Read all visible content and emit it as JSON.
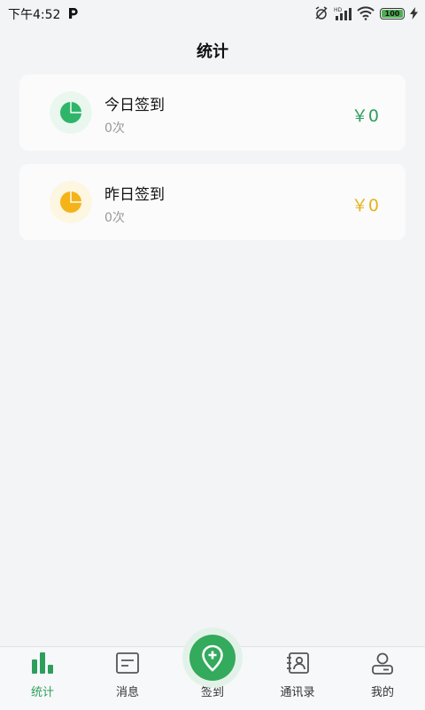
{
  "status_bar": {
    "time": "下午4:52",
    "battery": "100"
  },
  "header": {
    "title": "统计"
  },
  "cards": [
    {
      "title": "今日签到",
      "count": "0次",
      "amount": "￥0",
      "amount_color": "#2e9e5b",
      "icon": "pie-chart-icon"
    },
    {
      "title": "昨日签到",
      "count": "0次",
      "amount": "￥0",
      "amount_color": "#e6b31a",
      "icon": "pie-chart-icon"
    }
  ],
  "tabbar": {
    "tabs": [
      {
        "label": "统计",
        "icon": "bar-chart-icon",
        "active": true
      },
      {
        "label": "消息",
        "icon": "message-icon"
      },
      {
        "label": "签到",
        "icon": "location-pin-icon"
      },
      {
        "label": "通讯录",
        "icon": "contacts-icon"
      },
      {
        "label": "我的",
        "icon": "user-icon"
      }
    ]
  },
  "colors": {
    "accent": "#2e9e5b",
    "yellow": "#f5b31a",
    "background": "#f3f4f6"
  }
}
